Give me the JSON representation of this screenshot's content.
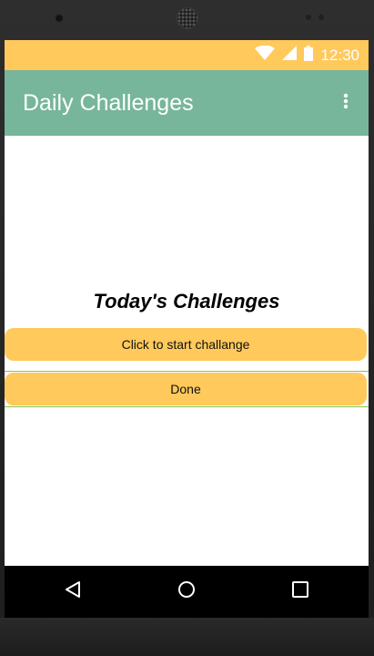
{
  "status_bar": {
    "time": "12:30",
    "background": "#ffc95c"
  },
  "app_bar": {
    "title": "Daily Challenges",
    "background": "#77b69a",
    "menu_icon": "more-vert-icon"
  },
  "main": {
    "heading": "Today's Challenges",
    "start_button_label": "Click to start challange",
    "done_button_label": "Done",
    "button_color": "#ffc95c",
    "outline_color": "#8bc34a"
  },
  "nav_bar": {
    "icons": [
      "back-icon",
      "home-icon",
      "recent-apps-icon"
    ]
  }
}
